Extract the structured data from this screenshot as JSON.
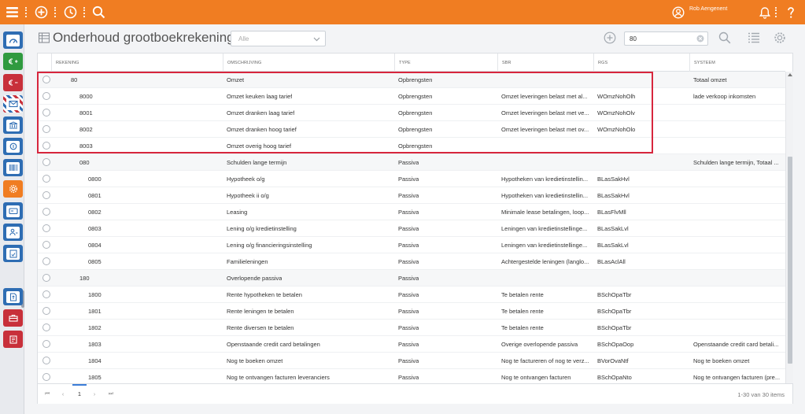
{
  "topbar": {
    "user_name": "Rob Aengenent",
    "icons": [
      "menu-icon",
      "add-icon",
      "history-icon",
      "search-icon",
      "user-icon",
      "notifications-icon",
      "help-icon"
    ]
  },
  "sidebar": {
    "items": [
      {
        "name": "dashboard",
        "icon": "speedometer-icon",
        "color": "#2e6db3"
      },
      {
        "name": "sales",
        "icon": "euro-plus-icon",
        "color": "#2f9a3f"
      },
      {
        "name": "purchases",
        "icon": "euro-minus-icon",
        "color": "#c8303a"
      },
      {
        "name": "mail",
        "icon": "envelope-icon",
        "color": "#2e6db3"
      },
      {
        "name": "bank",
        "icon": "bank-icon",
        "color": "#2e6db3"
      },
      {
        "name": "finance",
        "icon": "coins-icon",
        "color": "#2e6db3"
      },
      {
        "name": "barcode",
        "icon": "barcode-icon",
        "color": "#2e6db3"
      },
      {
        "name": "settings",
        "icon": "gear-icon",
        "color": "#f07d22"
      },
      {
        "name": "cards",
        "icon": "card-icon",
        "color": "#2e6db3"
      },
      {
        "name": "relations",
        "icon": "person-icon",
        "color": "#2e6db3"
      },
      {
        "name": "reports",
        "icon": "report-icon",
        "color": "#2e6db3"
      },
      {
        "name": "documents",
        "icon": "document-icon",
        "color": "#2e6db3"
      },
      {
        "name": "toolbox",
        "icon": "toolbox-icon",
        "color": "#c8303a"
      },
      {
        "name": "notes",
        "icon": "notes-icon",
        "color": "#c8303a"
      }
    ]
  },
  "header": {
    "title": "Onderhoud grootboekrekeningen",
    "filter_value": "Alle",
    "search_value": "80"
  },
  "grid": {
    "columns": [
      "REKENING",
      "OMSCHRIJVING",
      "TYPE",
      "SBR",
      "RGS",
      "SYSTEEM"
    ],
    "rows": [
      {
        "rekening": "80",
        "omschrijving": "Omzet",
        "type": "Opbrengsten",
        "sbr": "",
        "rgs": "",
        "systeem": "Totaal omzet",
        "level": 0,
        "group": true
      },
      {
        "rekening": "8000",
        "omschrijving": "Omzet keuken laag tarief",
        "type": "Opbrengsten",
        "sbr": "Omzet leveringen belast met al...",
        "rgs": "WOmzNohOlh",
        "systeem": "lade verkoop inkomsten",
        "level": 1,
        "group": false
      },
      {
        "rekening": "8001",
        "omschrijving": "Omzet dranken laag tarief",
        "type": "Opbrengsten",
        "sbr": "Omzet leveringen belast met ve...",
        "rgs": "WOmzNohOlv",
        "systeem": "",
        "level": 1,
        "group": false
      },
      {
        "rekening": "8002",
        "omschrijving": "Omzet dranken hoog tarief",
        "type": "Opbrengsten",
        "sbr": "Omzet leveringen belast met ov...",
        "rgs": "WOmzNohOlo",
        "systeem": "",
        "level": 1,
        "group": false
      },
      {
        "rekening": "8003",
        "omschrijving": "Omzet overig hoog tarief",
        "type": "Opbrengsten",
        "sbr": "",
        "rgs": "",
        "systeem": "",
        "level": 1,
        "group": false
      },
      {
        "rekening": "080",
        "omschrijving": "Schulden lange termijn",
        "type": "Passiva",
        "sbr": "",
        "rgs": "",
        "systeem": "Schulden lange termijn, Totaal ...",
        "level": 1,
        "group": true
      },
      {
        "rekening": "0800",
        "omschrijving": "Hypotheek o/g",
        "type": "Passiva",
        "sbr": "Hypotheken van kredietinstellin...",
        "rgs": "BLasSakHvl",
        "systeem": "",
        "level": 2,
        "group": false
      },
      {
        "rekening": "0801",
        "omschrijving": "Hypotheek ii o/g",
        "type": "Passiva",
        "sbr": "Hypotheken van kredietinstellin...",
        "rgs": "BLasSakHvl",
        "systeem": "",
        "level": 2,
        "group": false
      },
      {
        "rekening": "0802",
        "omschrijving": "Leasing",
        "type": "Passiva",
        "sbr": "Minimale lease betalingen, loop...",
        "rgs": "BLasFlvMll",
        "systeem": "",
        "level": 2,
        "group": false
      },
      {
        "rekening": "0803",
        "omschrijving": "Lening o/g kredietinstelling",
        "type": "Passiva",
        "sbr": "Leningen van kredietinstellinge...",
        "rgs": "BLasSakLvl",
        "systeem": "",
        "level": 2,
        "group": false
      },
      {
        "rekening": "0804",
        "omschrijving": "Lening o/g financieringsinstelling",
        "type": "Passiva",
        "sbr": "Leningen van kredietinstellinge...",
        "rgs": "BLasSakLvl",
        "systeem": "",
        "level": 2,
        "group": false
      },
      {
        "rekening": "0805",
        "omschrijving": "Familieleningen",
        "type": "Passiva",
        "sbr": "Achtergestelde leningen (langlo...",
        "rgs": "BLasAclAll",
        "systeem": "",
        "level": 2,
        "group": false
      },
      {
        "rekening": "180",
        "omschrijving": "Overlopende passiva",
        "type": "Passiva",
        "sbr": "",
        "rgs": "",
        "systeem": "",
        "level": 1,
        "group": true
      },
      {
        "rekening": "1800",
        "omschrijving": "Rente hypotheken te betalen",
        "type": "Passiva",
        "sbr": "Te betalen rente",
        "rgs": "BSchOpaTbr",
        "systeem": "",
        "level": 2,
        "group": false
      },
      {
        "rekening": "1801",
        "omschrijving": "Rente leningen te betalen",
        "type": "Passiva",
        "sbr": "Te betalen rente",
        "rgs": "BSchOpaTbr",
        "systeem": "",
        "level": 2,
        "group": false
      },
      {
        "rekening": "1802",
        "omschrijving": "Rente diversen te betalen",
        "type": "Passiva",
        "sbr": "Te betalen rente",
        "rgs": "BSchOpaTbr",
        "systeem": "",
        "level": 2,
        "group": false
      },
      {
        "rekening": "1803",
        "omschrijving": "Openstaande credit card betalingen",
        "type": "Passiva",
        "sbr": "Overige overlopende passiva",
        "rgs": "BSchOpaOop",
        "systeem": "Openstaande credit card betali...",
        "level": 2,
        "group": false
      },
      {
        "rekening": "1804",
        "omschrijving": "Nog te boeken omzet",
        "type": "Passiva",
        "sbr": "Nog te factureren of nog te verz...",
        "rgs": "BVorOvaNtf",
        "systeem": "Nog te boeken omzet",
        "level": 2,
        "group": false
      },
      {
        "rekening": "1805",
        "omschrijving": "Nog te ontvangen facturen leveranciers",
        "type": "Passiva",
        "sbr": "Nog te ontvangen facturen",
        "rgs": "BSchOpaNto",
        "systeem": "Nog te ontvangen facturen (pre...",
        "level": 2,
        "group": false
      }
    ]
  },
  "pager": {
    "current_page": "1",
    "info": "1-30 van 30 items"
  },
  "colors": {
    "accent": "#f07d22",
    "highlight": "#d7263d",
    "blue": "#2e6db3"
  }
}
